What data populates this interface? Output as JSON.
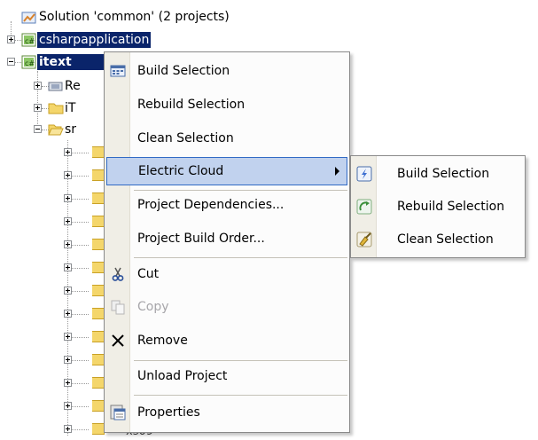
{
  "tree": {
    "solution_label": "Solution 'common' (2 projects)",
    "project1_label": "csharpapplication",
    "project2_label": "itext",
    "child1_label": "Re",
    "child2_label": "iT",
    "child3_label": "sr",
    "bottom_label": "xs09"
  },
  "context_menu": {
    "items": [
      {
        "label": "Build Selection",
        "icon": "build-solution-icon"
      },
      {
        "label": "Rebuild Selection"
      },
      {
        "label": "Clean Selection"
      },
      {
        "label": "Electric Cloud",
        "has_submenu": true
      },
      {
        "label": "Project Dependencies..."
      },
      {
        "label": "Project Build Order..."
      },
      {
        "label": "Cut",
        "icon": "scissors-icon"
      },
      {
        "label": "Copy",
        "icon": "copy-icon",
        "disabled": true
      },
      {
        "label": "Remove",
        "icon": "remove-x-icon"
      },
      {
        "label": "Unload Project"
      },
      {
        "label": "Properties",
        "icon": "properties-icon"
      }
    ]
  },
  "submenu": {
    "items": [
      {
        "label": "Build Selection",
        "icon": "ec-build-icon"
      },
      {
        "label": "Rebuild Selection",
        "icon": "ec-rebuild-icon"
      },
      {
        "label": "Clean Selection",
        "icon": "ec-clean-icon"
      }
    ]
  },
  "colors": {
    "selection": "#0a246a",
    "menu_highlight": "#c1d2ee",
    "menu_highlight_border": "#316ac5",
    "disabled_text": "#a7a6aa"
  }
}
